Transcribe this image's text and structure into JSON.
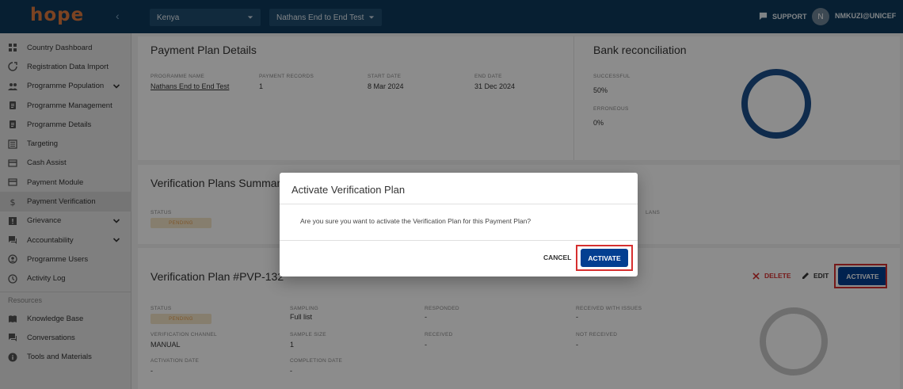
{
  "brand": {
    "logo": "hope"
  },
  "topbar": {
    "country": "Kenya",
    "programme": "Nathans End to End Test",
    "support_label": "SUPPORT",
    "avatar_initial": "N",
    "user": "NMKUZI@UNICEF"
  },
  "sidebar": {
    "items": [
      {
        "label": "Country Dashboard",
        "icon": "dashboard-icon"
      },
      {
        "label": "Registration Data Import",
        "icon": "import-icon"
      },
      {
        "label": "Programme Population",
        "icon": "people-icon",
        "expandable": true
      },
      {
        "label": "Programme Management",
        "icon": "clipboard-icon"
      },
      {
        "label": "Programme Details",
        "icon": "clipboard-icon"
      },
      {
        "label": "Targeting",
        "icon": "list-icon"
      },
      {
        "label": "Cash Assist",
        "icon": "card-icon"
      },
      {
        "label": "Payment Module",
        "icon": "card-icon"
      },
      {
        "label": "Payment Verification",
        "icon": "dollar-icon",
        "active": true
      },
      {
        "label": "Grievance",
        "icon": "grievance-icon",
        "expandable": true
      },
      {
        "label": "Accountability",
        "icon": "forum-icon",
        "expandable": true
      },
      {
        "label": "Programme Users",
        "icon": "user-icon"
      },
      {
        "label": "Activity Log",
        "icon": "history-icon"
      }
    ],
    "resources_label": "Resources",
    "resources": [
      {
        "label": "Knowledge Base",
        "icon": "book-icon"
      },
      {
        "label": "Conversations",
        "icon": "forum-icon"
      },
      {
        "label": "Tools and Materials",
        "icon": "info-icon"
      }
    ]
  },
  "details": {
    "title": "Payment Plan Details",
    "programme_name_label": "PROGRAMME NAME",
    "programme_name": "Nathans End to End Test",
    "payment_records_label": "PAYMENT RECORDS",
    "payment_records": "1",
    "start_date_label": "START DATE",
    "start_date": "8 Mar 2024",
    "end_date_label": "END DATE",
    "end_date": "31 Dec 2024"
  },
  "bank": {
    "title": "Bank reconciliation",
    "successful_label": "SUCCESSFUL",
    "successful": "50%",
    "erroneous_label": "ERRONEOUS",
    "erroneous": "0%"
  },
  "summary": {
    "title": "Verification Plans Summary",
    "status_label": "STATUS",
    "status": "PENDING",
    "plans_label": "LANS"
  },
  "plan": {
    "title": "Verification Plan #PVP-132",
    "delete_label": "DELETE",
    "edit_label": "EDIT",
    "activate_label": "ACTIVATE",
    "status_label": "STATUS",
    "status": "PENDING",
    "sampling_label": "SAMPLING",
    "sampling": "Full list",
    "responded_label": "RESPONDED",
    "responded": "-",
    "received_issues_label": "RECEIVED WITH ISSUES",
    "received_issues": "-",
    "channel_label": "VERIFICATION CHANNEL",
    "channel": "MANUAL",
    "sample_size_label": "SAMPLE SIZE",
    "sample_size": "1",
    "received_label": "RECEIVED",
    "received": "-",
    "not_received_label": "NOT RECEIVED",
    "not_received": "-",
    "activation_date_label": "ACTIVATION DATE",
    "activation_date": "-",
    "completion_date_label": "COMPLETION DATE",
    "completion_date": "-"
  },
  "modal": {
    "title": "Activate Verification Plan",
    "body": "Are you sure you want to activate the Verification Plan for this Payment Plan?",
    "cancel_label": "CANCEL",
    "activate_label": "ACTIVATE"
  },
  "colors": {
    "topbar": "#0d3a5c",
    "primary": "#033f91",
    "danger": "#d62f2f",
    "pending_bg": "#f5e6c8",
    "pending_text": "#e39a4a",
    "donut": "#1c4f8a"
  }
}
